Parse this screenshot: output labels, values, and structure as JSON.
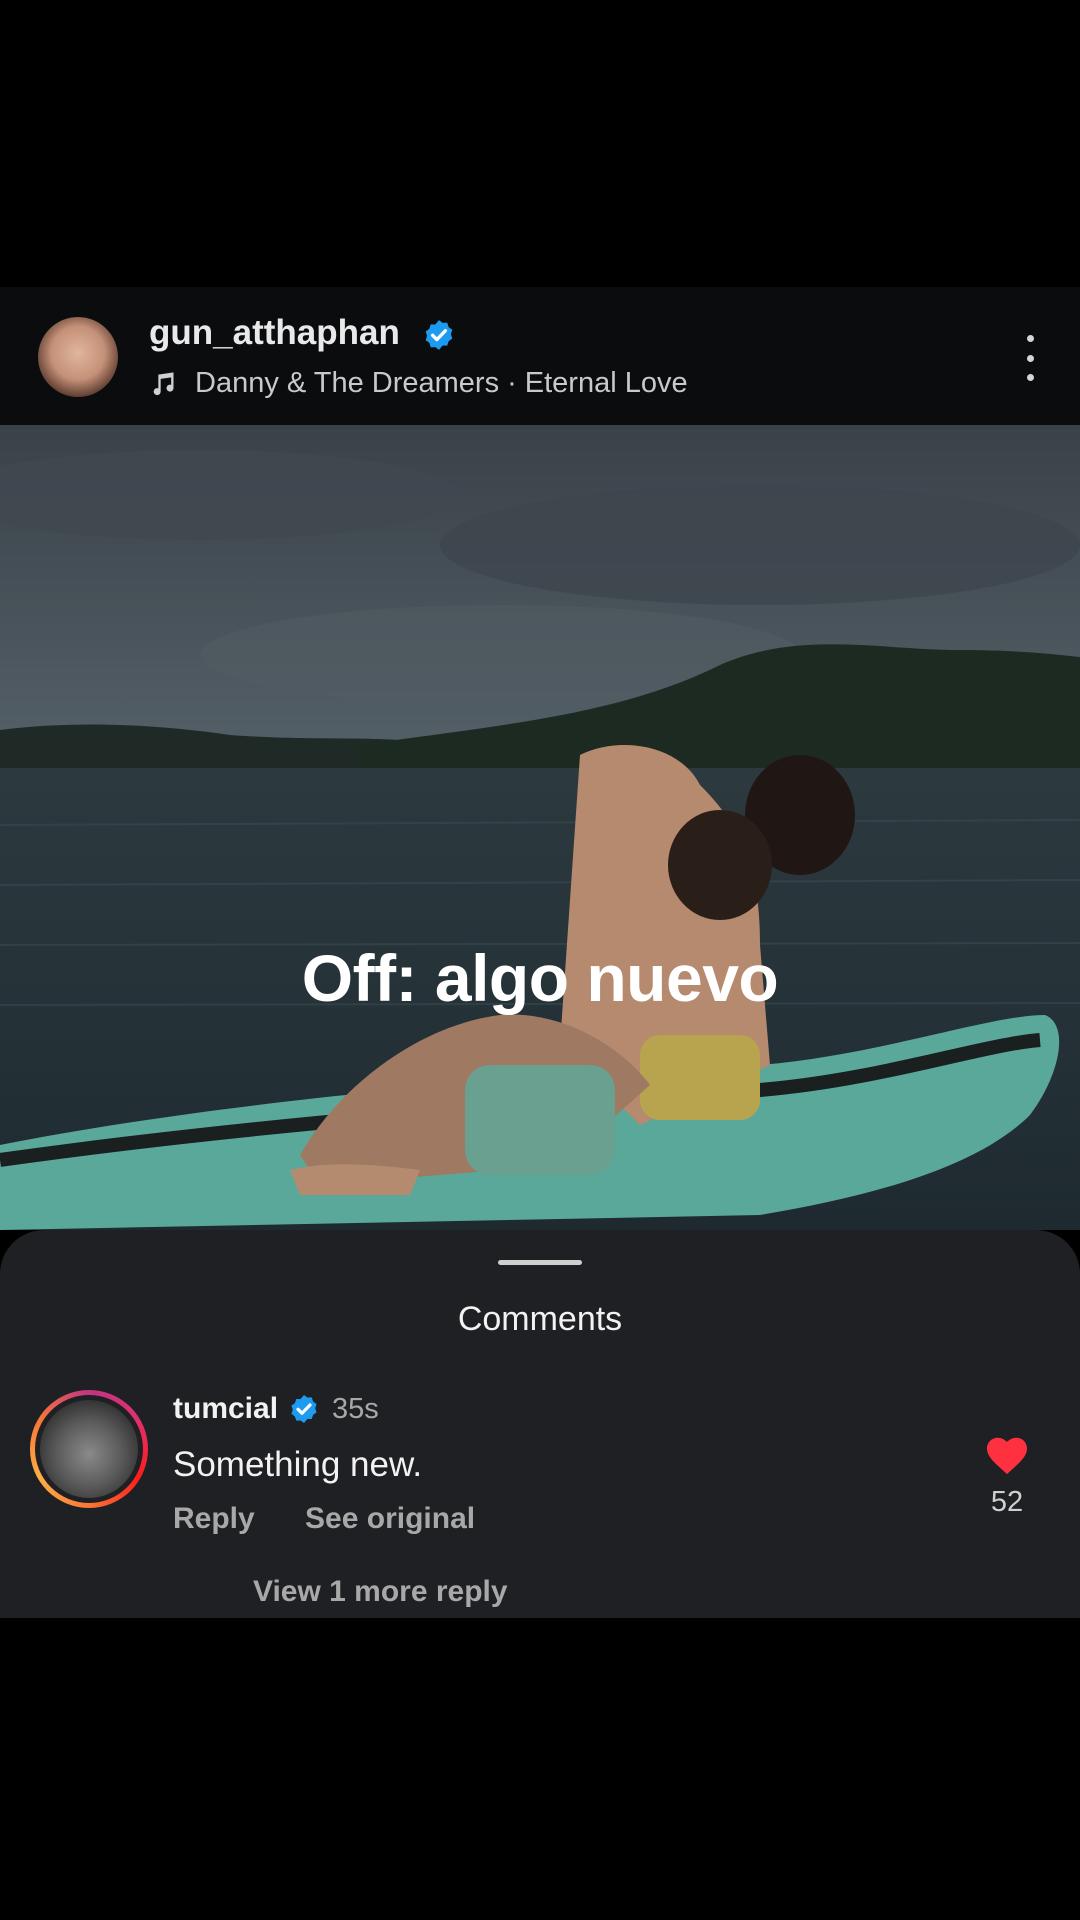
{
  "post": {
    "author": "gun_atthaphan",
    "music_artist": "Danny & The Dreamers",
    "music_separator": "·",
    "music_song": "Eternal Love",
    "overlay_text": "Off: algo nuevo"
  },
  "comments_sheet": {
    "title": "Comments",
    "comments": [
      {
        "username": "tumcial",
        "time": "35s",
        "text": "Something new.",
        "reply_label": "Reply",
        "see_original_label": "See original",
        "like_count": "52",
        "view_replies_label": "View 1 more reply"
      }
    ]
  },
  "colors": {
    "verified": "#1d9bf0",
    "like_heart": "#ff3040",
    "sheet_background": "#1f2024"
  }
}
